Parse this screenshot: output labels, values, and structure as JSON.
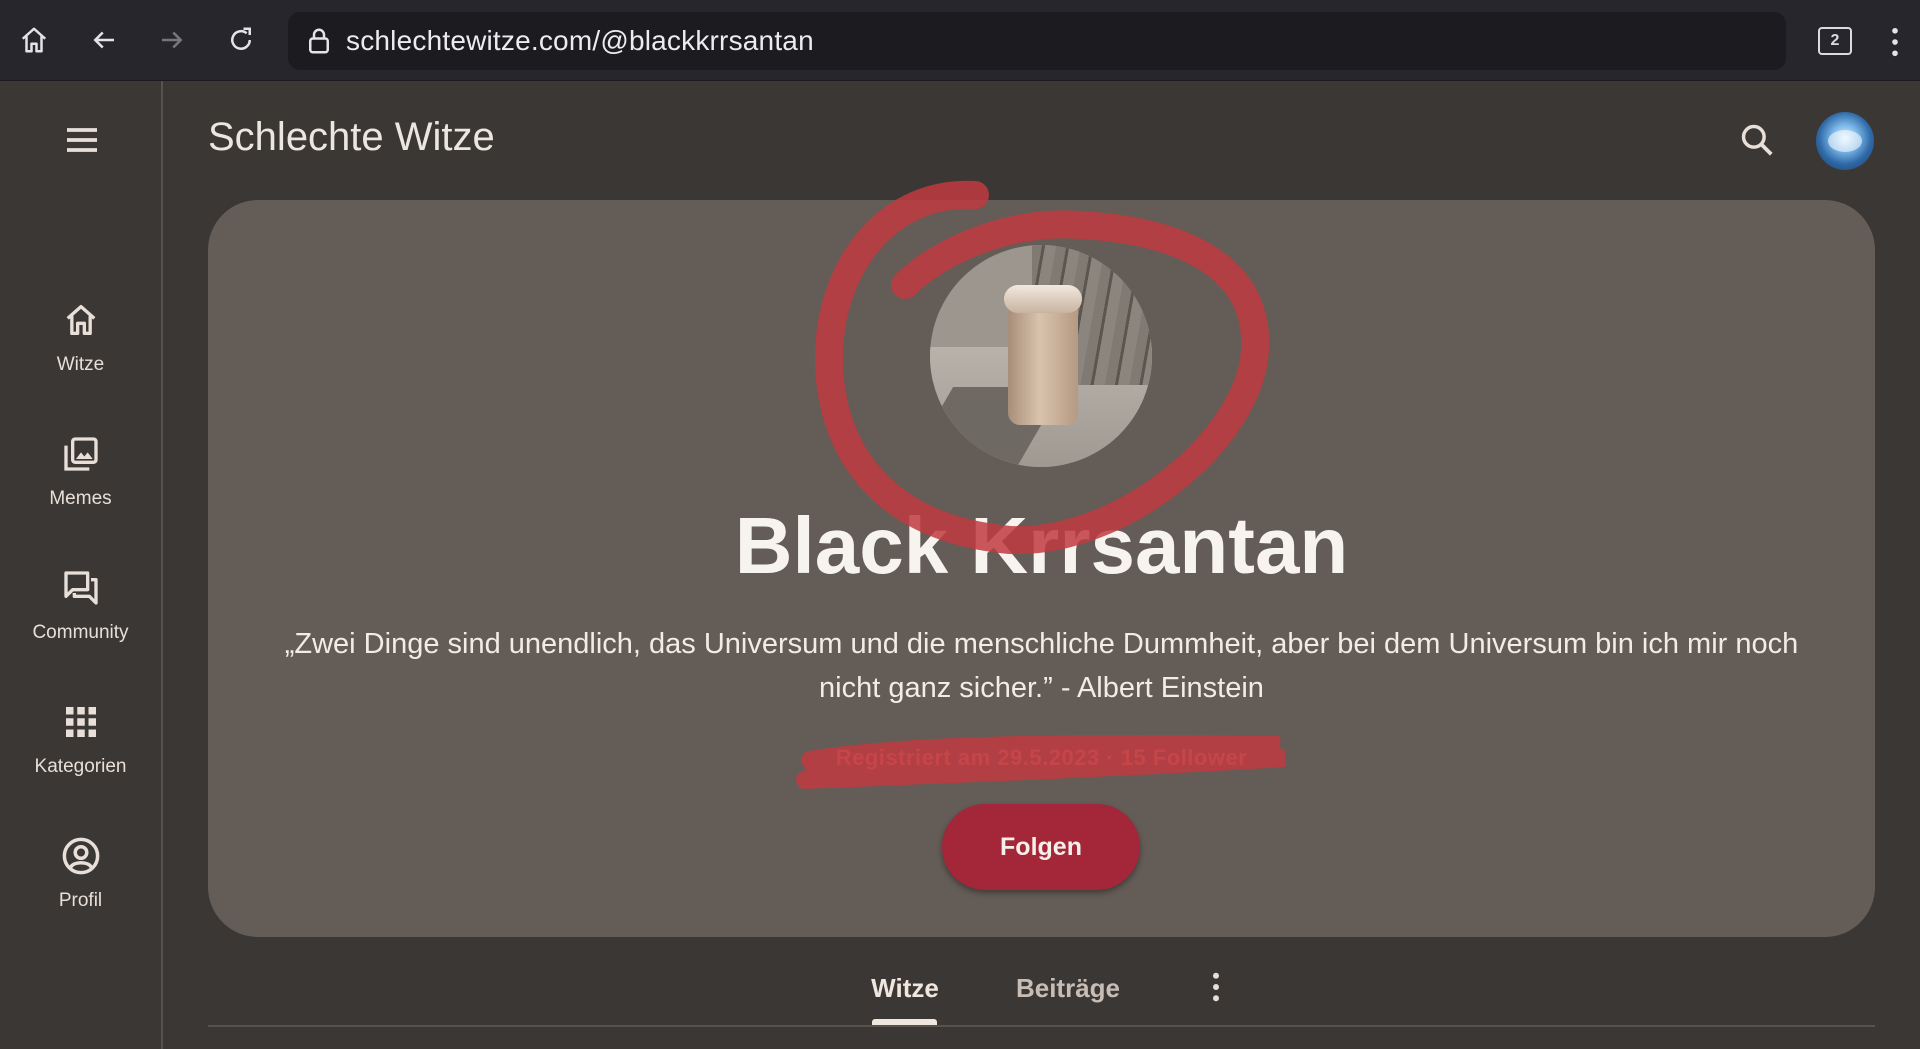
{
  "browser": {
    "url": "schlechtewitze.com/@blackkrrsantan",
    "tab_count": "2"
  },
  "app": {
    "title": "Schlechte Witze"
  },
  "nav": {
    "items": [
      {
        "label": "Witze",
        "icon": "home-icon"
      },
      {
        "label": "Memes",
        "icon": "image-library-icon"
      },
      {
        "label": "Community",
        "icon": "forum-icon"
      },
      {
        "label": "Kategorien",
        "icon": "grid-icon"
      },
      {
        "label": "Profil",
        "icon": "account-circle-icon"
      }
    ]
  },
  "profile": {
    "name": "Black Krrsantan",
    "bio": "„Zwei Dinge sind unendlich, das Universum und die menschliche Dummheit, aber bei dem Universum bin ich mir noch nicht ganz sicher.” - Albert Einstein",
    "meta": "Registriert am 29.5.2023 · 15 Follower",
    "follow_label": "Folgen"
  },
  "tabs": [
    {
      "label": "Witze",
      "active": true
    },
    {
      "label": "Beiträge",
      "active": false
    }
  ],
  "colors": {
    "accent": "#a32639",
    "card": "#645c56",
    "background": "#3b3735",
    "annotation": "#c0393f"
  }
}
